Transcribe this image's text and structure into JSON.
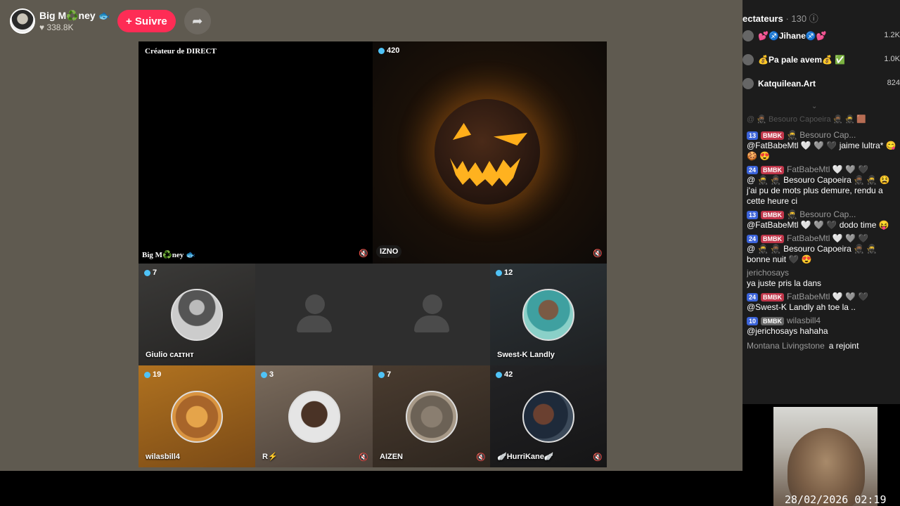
{
  "header": {
    "host_name": "Big M♻️ney 🐟",
    "likes": "♥ 338.8K",
    "follow_label": "+ Suivre",
    "share_icon": "share-icon"
  },
  "grid": {
    "creator_tag": "Créateur de DIRECT",
    "host_tile_name": "Big M♻️ney 🐟",
    "izno": {
      "count": "420",
      "name": "IZNO"
    },
    "tiles": [
      {
        "count": "7",
        "name": "Giulio ᴄᴀɪᴛʜᴛ"
      },
      {
        "count": "",
        "name": ""
      },
      {
        "count": "",
        "name": ""
      },
      {
        "count": "12",
        "name": "Swest-K Landly"
      },
      {
        "count": "19",
        "name": "wilasbill4"
      },
      {
        "count": "3",
        "name": "R⚡"
      },
      {
        "count": "7",
        "name": "AIZEN"
      },
      {
        "count": "42",
        "name": "🪽HurriKane🪽"
      }
    ]
  },
  "panel": {
    "title": "ectateurs",
    "count": "· 130",
    "top": [
      {
        "name": "💕♐Jihane♐💕",
        "score": "1.2K"
      },
      {
        "name": "💰Pa pale avem💰 ✅",
        "score": "1.0K"
      },
      {
        "name": "Katquilean.Art",
        "score": "824"
      }
    ],
    "faded": "@ 🥷🏾 Besouro Capoeira 🥷🏾 🥷 🟫",
    "messages": [
      {
        "lvl": "13",
        "fan": "BMBK",
        "sender": "🥷 Besouro Cap...",
        "text": "@FatBabeMtl 🤍 🩶 🖤 jaime lultra* 😋 🍪 😍"
      },
      {
        "lvl": "24",
        "fan": "BMBK",
        "sender": "FatBabeMtl 🤍 🩶 🖤",
        "text": "@ 🥷 🥷🏾 Besouro Capoeira 🥷🏾 🥷 😫 j'ai pu de mots plus demure, rendu a cette heure ci"
      },
      {
        "lvl": "13",
        "fan": "BMBK",
        "sender": "🥷 Besouro Cap...",
        "text": "@FatBabeMtl 🤍 🩶 🖤 dodo time 😝"
      },
      {
        "lvl": "24",
        "fan": "BMBK",
        "sender": "FatBabeMtl 🤍 🩶 🖤",
        "text": "@ 🥷 🥷🏾 Besouro Capoeira 🥷🏾 🥷 bonne nuit 🖤 😍"
      },
      {
        "lvl": "",
        "fan": "",
        "sender": "jerichosays",
        "text": "ya juste pris la dans"
      },
      {
        "lvl": "24",
        "fan": "BMBK",
        "sender": "FatBabeMtl 🤍 🩶 🖤",
        "text": "@Swest-K Landly ah toe la .."
      },
      {
        "lvl": "10",
        "fan": "BMBK",
        "sender": "wilasbill4",
        "text": "@jerichosays hahaha"
      }
    ],
    "joined": {
      "sender": "Montana Livingstone",
      "text": "a rejoint"
    }
  },
  "overlay": {
    "timestamp": "28/02/2026 02:19"
  }
}
